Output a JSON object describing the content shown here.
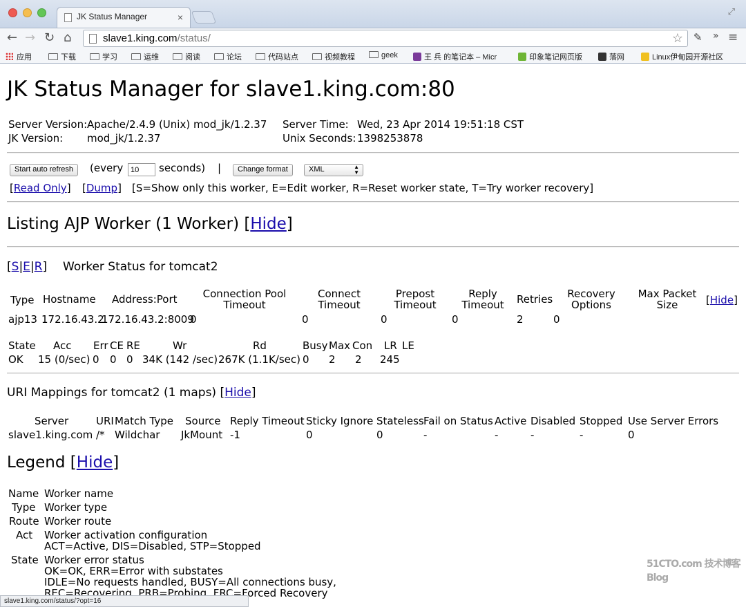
{
  "browser": {
    "tab_title": "JK Status Manager",
    "url_host": "slave1.king.com",
    "url_path": "/status/",
    "bookmarks": [
      "应用",
      "下载",
      "学习",
      "运维",
      "阅读",
      "论坛",
      "代码站点",
      "视频教程",
      "geek",
      "王 兵 的笔记本 – Micr",
      "印象笔记网页版",
      "落网",
      "Linux伊甸园开源社区"
    ],
    "status_url": "slave1.king.com/status/?opt=16",
    "watermark": "51CTO.com 技术博客 Blog"
  },
  "page": {
    "title": "JK Status Manager for slave1.king.com:80",
    "server_version_label": "Server Version:",
    "server_version": "Apache/2.4.9 (Unix) mod_jk/1.2.37",
    "jk_version_label": "JK Version:",
    "jk_version": "mod_jk/1.2.37",
    "server_time_label": "Server Time:",
    "server_time": "Wed, 23 Apr 2014 19:51:18 CST",
    "unix_seconds_label": "Unix Seconds:",
    "unix_seconds": "1398253878",
    "auto_refresh_button": "Start auto refresh",
    "every_label": "(every",
    "refresh_value": "10",
    "seconds_label": "seconds)",
    "pipe": "|",
    "change_format_button": "Change format",
    "format_selected": "XML",
    "read_only_link": "Read Only",
    "dump_link": "Dump",
    "legend_hint": "[S=Show only this worker, E=Edit worker, R=Reset worker state, T=Try worker recovery]",
    "worker_section_title": "Listing AJP Worker (1 Worker)",
    "hide": "Hide",
    "action_s": "S",
    "action_e": "E",
    "action_r": "R",
    "worker_status_title": "Worker Status for tomcat2",
    "worker_headers": [
      "Type",
      "Hostname",
      "Address:Port",
      "Connection Pool Timeout",
      "Connect Timeout",
      "Prepost Timeout",
      "Reply Timeout",
      "Retries",
      "Recovery Options",
      "Max Packet Size"
    ],
    "worker_row": [
      "ajp13",
      "172.16.43.2",
      "172.16.43.2:8009",
      "0",
      "0",
      "0",
      "0",
      "2",
      "0",
      ""
    ],
    "state_headers": [
      "State",
      "Acc",
      "Err",
      "CE",
      "RE",
      "Wr",
      "Rd",
      "Busy",
      "Max",
      "Con",
      "LR",
      "LE"
    ],
    "state_row": [
      "OK",
      "15 (0/sec)",
      "0",
      "0",
      "0",
      "34K (142 /sec)",
      "267K (1.1K/sec)",
      "0",
      "2",
      "2",
      "245",
      ""
    ],
    "uri_title": "URI Mappings for tomcat2 (1 maps)",
    "uri_headers": [
      "Server",
      "URI",
      "Match Type",
      "Source",
      "Reply Timeout",
      "Sticky Ignore",
      "Stateless",
      "Fail on Status",
      "Active",
      "Disabled",
      "Stopped",
      "Use Server Errors"
    ],
    "uri_row": [
      "slave1.king.com",
      "/*",
      "Wildchar",
      "JkMount",
      "-1",
      "0",
      "0",
      "-",
      "-",
      "-",
      "-",
      "0"
    ],
    "legend_title": "Legend",
    "legend": [
      {
        "key": "Name",
        "lines": [
          "Worker name"
        ]
      },
      {
        "key": "Type",
        "lines": [
          "Worker type"
        ]
      },
      {
        "key": "Route",
        "lines": [
          "Worker route"
        ]
      },
      {
        "key": "Act",
        "lines": [
          "Worker activation configuration",
          "ACT=Active, DIS=Disabled, STP=Stopped"
        ]
      },
      {
        "key": "State",
        "lines": [
          "Worker error status",
          "OK=OK, ERR=Error with substates",
          "IDLE=No requests handled, BUSY=All connections busy,",
          "REC=Recovering, PRB=Probing, FRC=Forced Recovery"
        ]
      }
    ]
  }
}
